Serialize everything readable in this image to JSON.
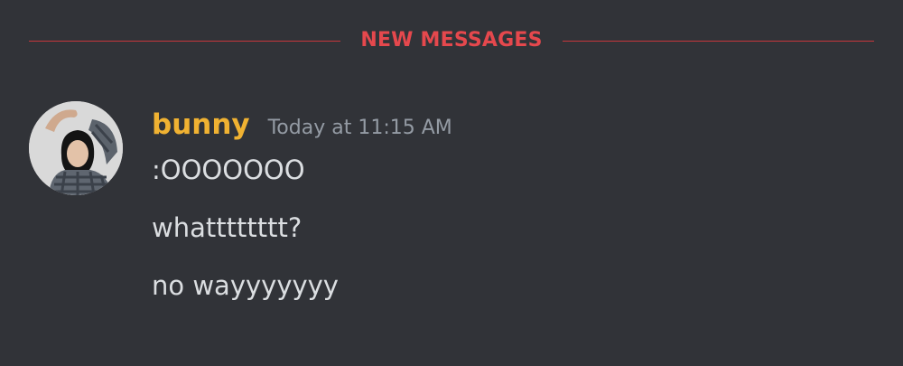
{
  "divider": {
    "label": "NEW MESSAGES",
    "color": "#e5484d"
  },
  "message_group": {
    "username": "bunny",
    "username_color": "#f0b232",
    "timestamp": "Today at 11:15 AM",
    "avatar_icon": "user-avatar-photo",
    "messages": [
      ":OOOOOOO",
      "whatttttttt?",
      "no wayyyyyyy"
    ]
  },
  "colors": {
    "background": "#313338",
    "message_text": "#dbdee1",
    "timestamp_text": "#949ba4"
  }
}
